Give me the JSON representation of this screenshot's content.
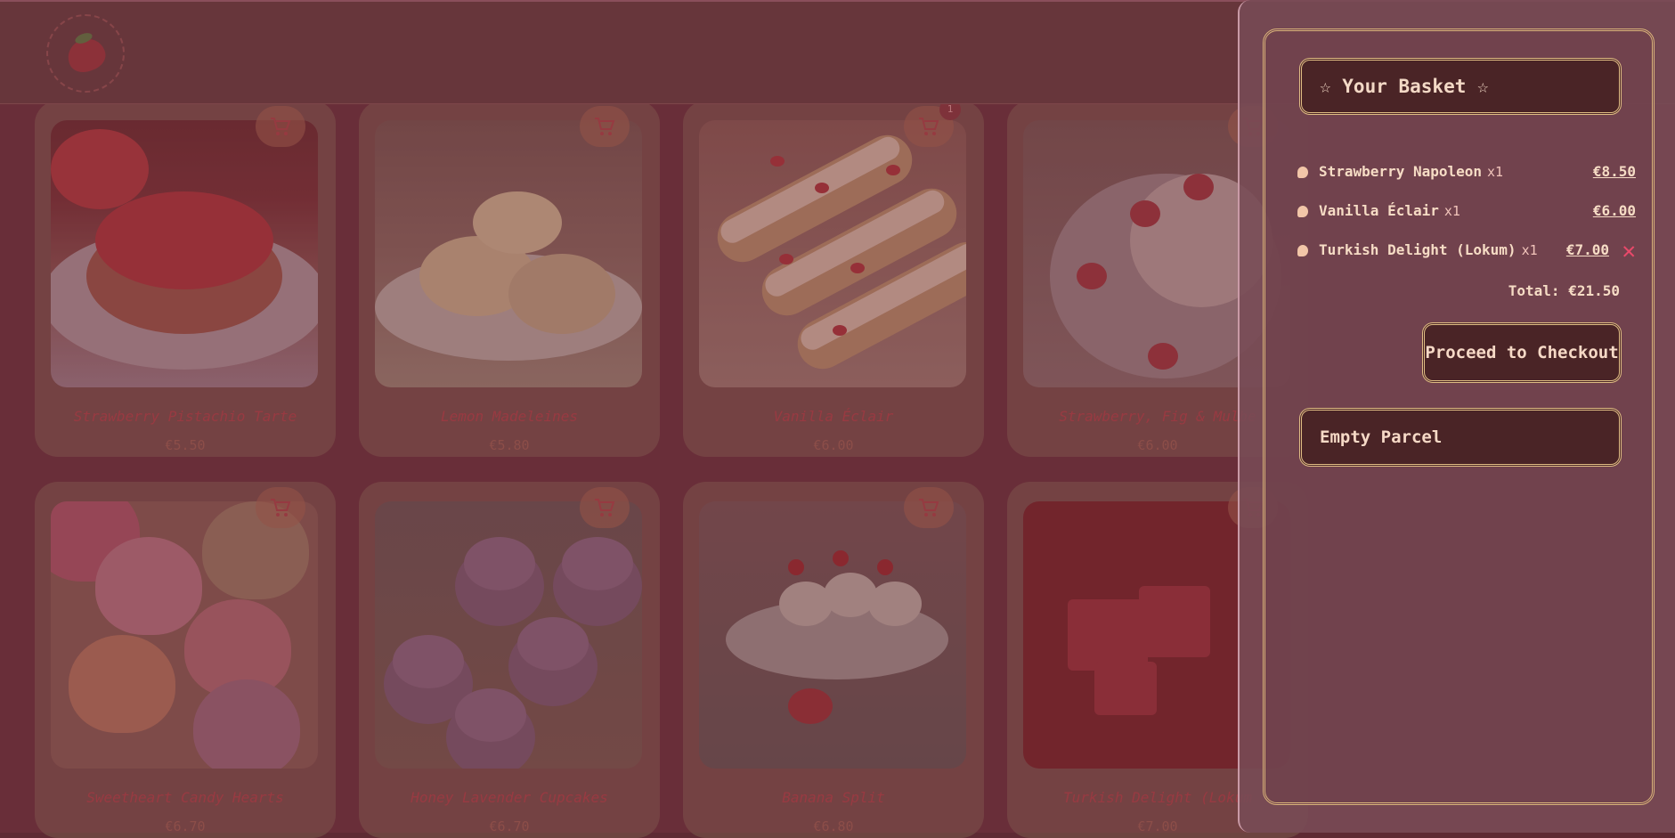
{
  "products": [
    {
      "name": "Strawberry Pistachio Tarte",
      "price": "€5.50"
    },
    {
      "name": "Lemon Madeleines",
      "price": "€5.80"
    },
    {
      "name": "Vanilla Éclair",
      "price": "€6.00"
    },
    {
      "name": "Strawberry, Fig & Mulbe",
      "price": "€6.00"
    },
    {
      "name": "Sweetheart Candy Hearts",
      "price": "€6.70"
    },
    {
      "name": "Honey Lavender Cupcakes",
      "price": "€6.70"
    },
    {
      "name": "Banana Split",
      "price": "€6.80"
    },
    {
      "name": "Turkish Delight (Lokum",
      "price": "€7.00"
    }
  ],
  "badge": "1",
  "basket": {
    "title": "☆ Your Basket ☆",
    "items": [
      {
        "name": "Strawberry Napoleon",
        "qty": "x1",
        "price": "€8.50"
      },
      {
        "name": "Vanilla Éclair",
        "qty": "x1",
        "price": "€6.00"
      },
      {
        "name": "Turkish Delight (Lokum)",
        "qty": "x1",
        "price": "€7.00",
        "remove": "✕"
      }
    ],
    "total": "Total: €21.50",
    "checkout": "Proceed to Checkout",
    "empty": "Empty Parcel"
  },
  "colors": {
    "accent": "#e0bd84",
    "remove": "#e8496a",
    "panel": "#4a2426"
  },
  "icons": {
    "logo": "strawberry-logo-icon",
    "cart": "cart-icon",
    "remove": "close-icon",
    "bullet": "heart-bullet-icon"
  }
}
